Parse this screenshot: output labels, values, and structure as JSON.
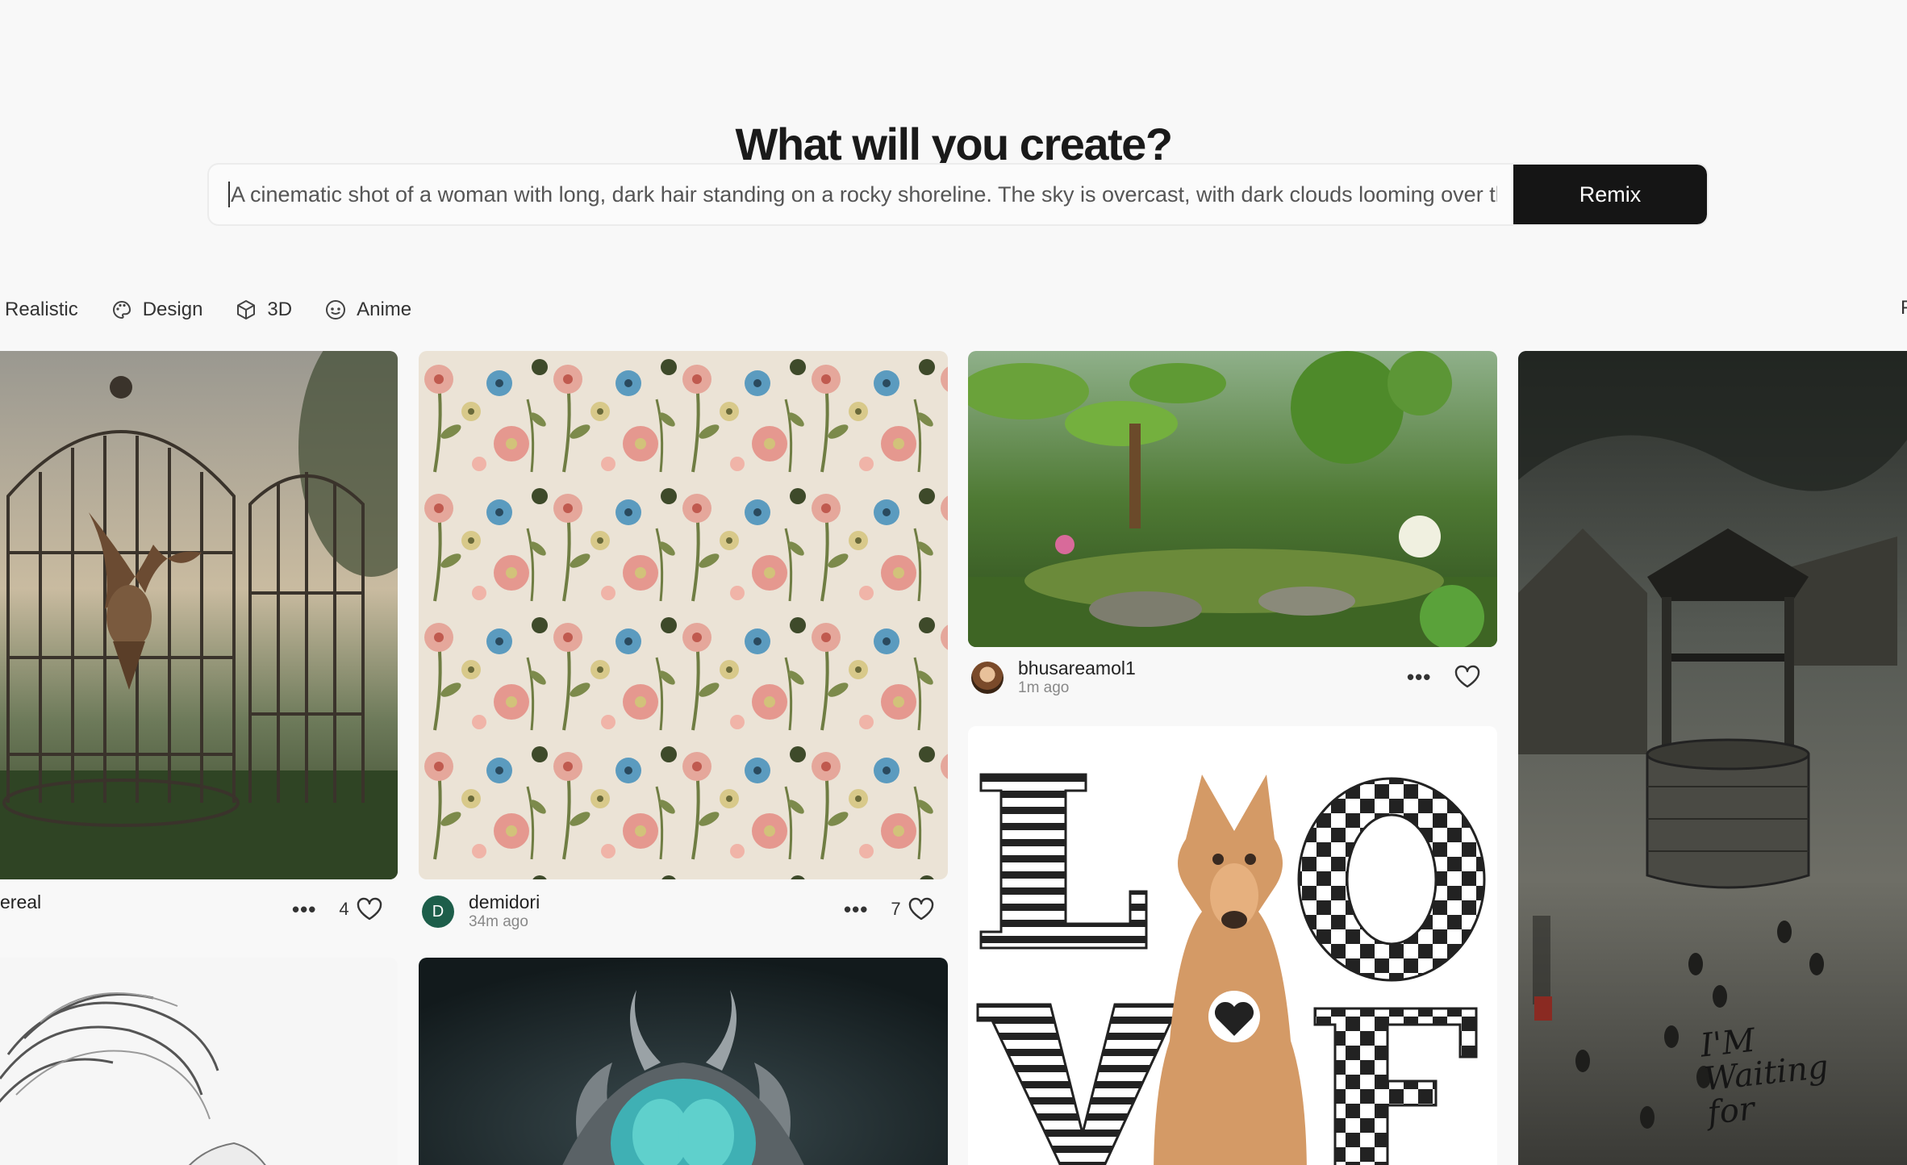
{
  "hero": {
    "title": "What will you create?"
  },
  "prompt": {
    "value": "A cinematic shot of a woman with long, dark hair standing on a rocky shoreline. The sky is overcast, with dark clouds looming over the h",
    "button_label": "Remix"
  },
  "filters": [
    {
      "label": "Realistic",
      "icon": "none"
    },
    {
      "label": "Design",
      "icon": "palette-icon"
    },
    {
      "label": "3D",
      "icon": "cube-icon"
    },
    {
      "label": "Anime",
      "icon": "smile-face-icon"
    }
  ],
  "filter_cutoff": "F",
  "cards": [
    {
      "image": "birdcage-with-bird",
      "username_partial": "ereal",
      "likes": "4"
    },
    {
      "image": "floral-pattern",
      "username": "demidori",
      "avatar_letter": "D",
      "time": "34m ago",
      "likes": "7"
    },
    {
      "image": "cartoon-jungle",
      "username": "bhusareamol1",
      "time": "1m ago"
    },
    {
      "image": "love-dog-typography"
    },
    {
      "image": "stone-well-village"
    },
    {
      "image": "pencil-sketch-woman"
    },
    {
      "image": "horned-headdress-portrait"
    }
  ],
  "well_caption": "I'M Waiting for"
}
